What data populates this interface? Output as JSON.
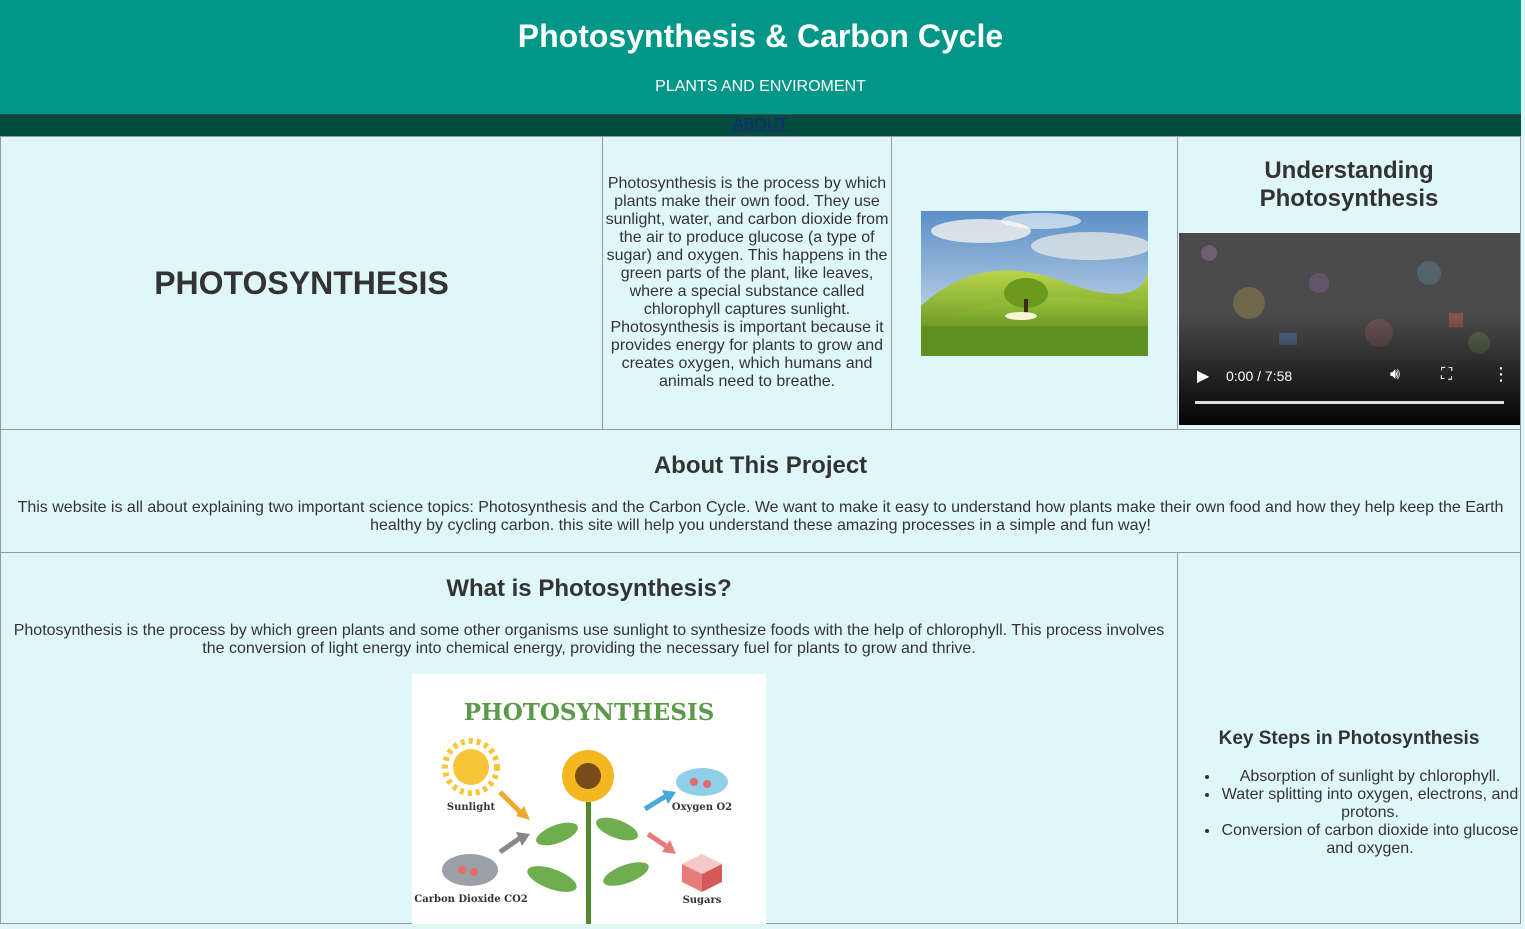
{
  "header": {
    "title": "Photosynthesis & Carbon Cycle",
    "subtitle": "PLANTS AND ENVIROMENT"
  },
  "nav": {
    "about_link": "ABOUT"
  },
  "intro": {
    "heading": "PHOTOSYNTHESIS",
    "text": "Photosynthesis is the process by which plants make their own food. They use sunlight, water, and carbon dioxide from the air to produce glucose (a type of sugar) and oxygen. This happens in the green parts of the plant, like leaves, where a special substance called chlorophyll captures sunlight. Photosynthesis is important because it provides energy for plants to grow and creates oxygen, which humans and animals need to breathe."
  },
  "video": {
    "heading": "Understanding Photosynthesis",
    "time": "0:00 / 7:58",
    "progress": 0
  },
  "about": {
    "heading": "About This Project",
    "text": "This website is all about explaining two important science topics: Photosynthesis and the Carbon Cycle. We want to make it easy to understand how plants make their own food and how they help keep the Earth healthy by cycling carbon. this site will help you understand these amazing processes in a simple and fun way!"
  },
  "what": {
    "heading": "What is Photosynthesis?",
    "text": "Photosynthesis is the process by which green plants and some other organisms use sunlight to synthesize foods with the help of chlorophyll. This process involves the conversion of light energy into chemical energy, providing the necessary fuel for plants to grow and thrive."
  },
  "diagram": {
    "title": "PHOTOSYNTHESIS",
    "labels": {
      "sunlight": "Sunlight",
      "oxygen": "Oxygen O2",
      "co2": "Carbon Dioxide CO2",
      "sugars": "Sugars"
    }
  },
  "steps": {
    "heading": "Key Steps in Photosynthesis",
    "items": [
      "Absorption of sunlight by chlorophyll.",
      "Water splitting into oxygen, electrons, and protons.",
      "Conversion of carbon dioxide into glucose and oxygen."
    ]
  },
  "colors": {
    "header": "#009688",
    "nav": "#004d40",
    "background": "#e0f7fa",
    "text": "#333333"
  }
}
